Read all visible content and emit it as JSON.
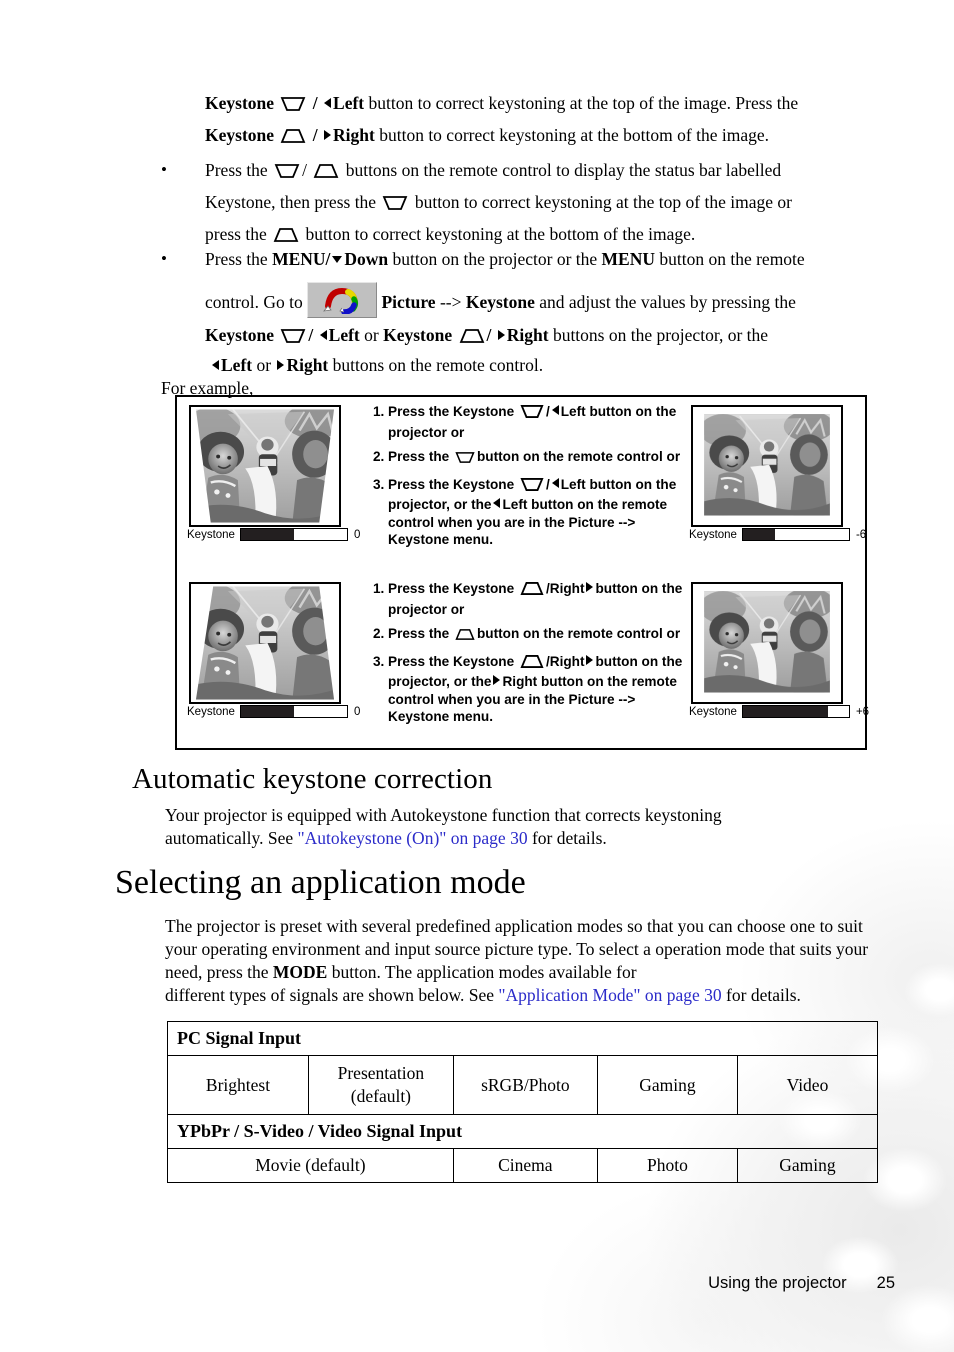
{
  "page": {
    "number": "25",
    "footer_label": "Using the projector"
  },
  "intro": {
    "line1_a": "Keystone",
    "line1_b": "/",
    "line1_c": "Left",
    "line1_d": " button to correct keystoning at the top of the image. Press the",
    "line2_a": "Keystone",
    "line2_b": "/",
    "line2_c": "Right",
    "line2_d": " button to correct keystoning at the bottom of the image."
  },
  "bullets": [
    {
      "marker": "•",
      "seg1": "Press the ",
      "seg2": "/",
      "seg3": " buttons on the remote control to display the status bar labelled",
      "seg4": "Keystone, then press the ",
      "seg5": " button to correct keystoning at the top of the image or",
      "seg6": "press the ",
      "seg7": " button to correct keystoning at the bottom of the image."
    },
    {
      "marker": "•",
      "seg1": "Press the ",
      "menu1": "MENU/",
      "down": "Down",
      "seg2": " button on the projector or the ",
      "menu2": "MENU",
      "seg3": " button on the remote",
      "seg4": "control. Go to ",
      "picture": "Picture",
      "arrowtxt": " --> ",
      "keystone_word": "Keystone",
      "seg5": " and adjust the values by pressing the",
      "seg6a": "Keystone",
      "seg6b": "/",
      "seg6c": "Left",
      "seg6d": " or ",
      "seg6e": "Keystone",
      "seg6f": "/",
      "seg6g": "Right",
      "seg6h": " buttons on the projector, or the",
      "seg7a": "Left",
      "seg7b": " or ",
      "seg7c": "Right",
      "seg7d": " buttons on the remote control."
    }
  ],
  "for_example": "For example,",
  "example_box": {
    "top": {
      "before": {
        "status_label": "Keystone",
        "status_value": "0",
        "fill_percent": 50
      },
      "after": {
        "status_label": "Keystone",
        "status_value": "-6",
        "fill_percent": 30
      },
      "steps": [
        {
          "num": "1.",
          "a": "Press the Keystone",
          "b": "/",
          "c": "Left button on the projector or"
        },
        {
          "num": "2.",
          "a": "Press the",
          "b": "button on the remote control or"
        },
        {
          "num": "3.",
          "a": "Press the Keystone",
          "b": "/",
          "c": "Left button on the projector, or the",
          "d": "Left button on the remote control when you are in the Picture --> Keystone menu."
        }
      ]
    },
    "bottom": {
      "before": {
        "status_label": "Keystone",
        "status_value": "0",
        "fill_percent": 50
      },
      "after": {
        "status_label": "Keystone",
        "status_value": "+6",
        "fill_percent": 80
      },
      "steps": [
        {
          "num": "1.",
          "a": "Press the Keystone",
          "b": "/Right",
          "c": "button on the projector or"
        },
        {
          "num": "2.",
          "a": "Press the",
          "b": "button on the remote control or"
        },
        {
          "num": "3.",
          "a": "Press the Keystone",
          "b": "/Right",
          "c": "button on the projector, or the",
          "d": "Right button on the remote control when you are in the Picture --> Keystone menu."
        }
      ]
    }
  },
  "auto_keystone": {
    "heading": "Automatic keystone correction",
    "body_a": "Your projector is equipped with Autokeystone function that corrects keystoning automatically. See ",
    "link": "\"Autokeystone (On)\" on page 30",
    "body_b": " for details."
  },
  "app_mode": {
    "heading": "Selecting an application mode",
    "body_a": "The projector is preset with several predefined application modes so that you can choose one to suit your operating environment and input source picture type. To select a operation mode that suits your need, press the ",
    "mode_button": "MODE",
    "body_b": " button. The application modes available for",
    "body_c": "different types of signals are shown below. See ",
    "link": "\"Application Mode\" on page 30",
    "body_d": " for details."
  },
  "mode_table": {
    "section1_header": "PC Signal Input",
    "section1_modes": [
      "Brightest",
      "Presentation (default)",
      "sRGB/Photo",
      "Gaming",
      "Video"
    ],
    "section2_header": "YPbPr / S-Video / Video Signal Input",
    "section2_modes": [
      "Movie (default)",
      "Cinema",
      "Photo",
      "Gaming"
    ]
  },
  "colors": {
    "link": "#2b2bc9",
    "bar_fill": "#231f20",
    "icon_bg": "#c0c0c0"
  }
}
